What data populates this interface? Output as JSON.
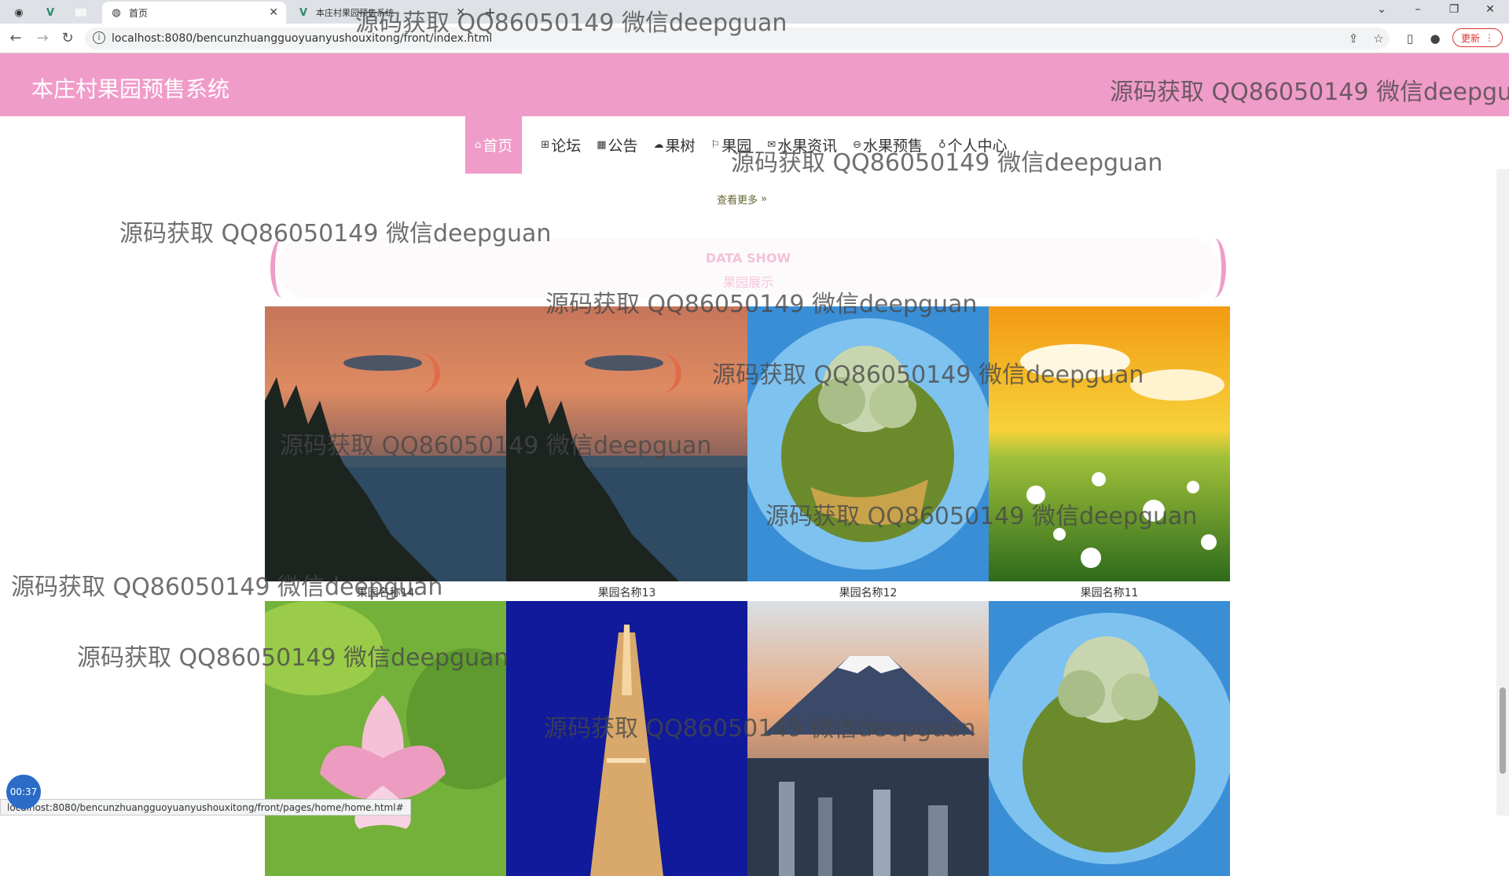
{
  "browser": {
    "tabs": [
      {
        "label": "",
        "icon": "github-icon"
      },
      {
        "label": "",
        "icon": "vue-icon"
      },
      {
        "label": "",
        "icon": "blank-icon"
      },
      {
        "label": "首页",
        "icon": "globe-icon",
        "active": true
      },
      {
        "label": "本庄村果园预售系统",
        "icon": "vue-icon"
      }
    ],
    "new_tab": "+",
    "url": "localhost:8080/bencunzhuangguoyuanyushouxitong/front/index.html",
    "update_label": "更新",
    "status_url": "localhost:8080/bencunzhuangguoyuanyushouxitong/front/pages/home/home.html#"
  },
  "site": {
    "title": "本庄村果园预售系统",
    "accent": "#f09cc8"
  },
  "nav": [
    {
      "label": "首页",
      "icon": "home-icon",
      "active": true
    },
    {
      "label": "论坛",
      "icon": "forum-icon"
    },
    {
      "label": "公告",
      "icon": "notice-icon"
    },
    {
      "label": "果树",
      "icon": "tree-icon"
    },
    {
      "label": "果园",
      "icon": "flag-icon"
    },
    {
      "label": "水果资讯",
      "icon": "mail-icon"
    },
    {
      "label": "水果预售",
      "icon": "cart-icon"
    },
    {
      "label": "个人中心",
      "icon": "user-icon"
    }
  ],
  "view_more": "查看更多",
  "section": {
    "en": "DATA SHOW",
    "cn": "果园展示"
  },
  "orchards": [
    {
      "caption": "果园名称14",
      "image": "sunset-lake"
    },
    {
      "caption": "果园名称13",
      "image": "sunset-lake"
    },
    {
      "caption": "果园名称12",
      "image": "tiny-planet"
    },
    {
      "caption": "果园名称11",
      "image": "daisy-field"
    },
    {
      "caption": "",
      "image": "lotus-flower"
    },
    {
      "caption": "",
      "image": "eiffel-tower"
    },
    {
      "caption": "",
      "image": "mount-fuji"
    },
    {
      "caption": "",
      "image": "tiny-planet"
    }
  ],
  "watermark": "源码获取 QQ86050149 微信deepguan",
  "timer": "00:37"
}
